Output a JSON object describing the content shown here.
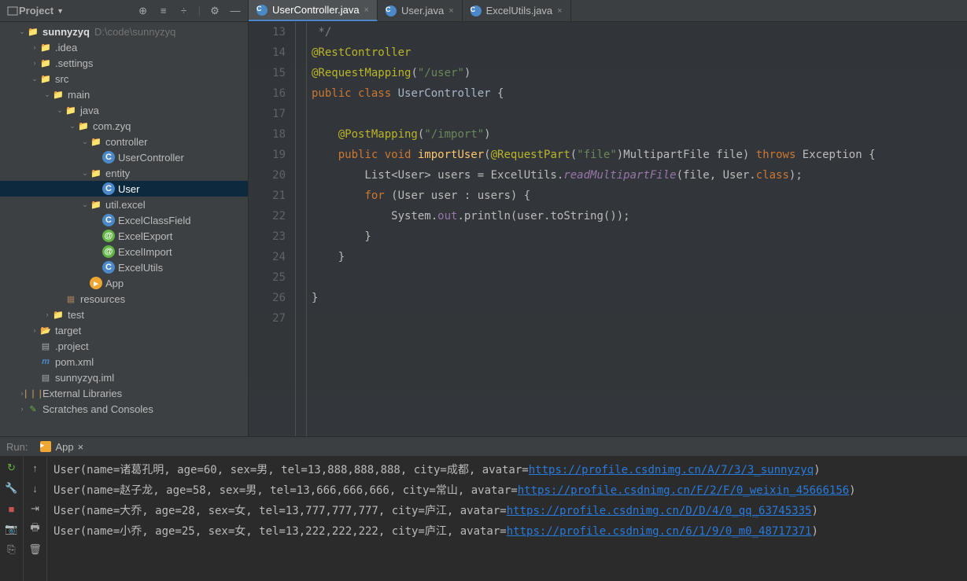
{
  "sidebar": {
    "title": "Project",
    "root": {
      "name": "sunnyzyq",
      "path": "D:\\code\\sunnyzyq"
    },
    "nodes": [
      {
        "d": 1,
        "e": "v",
        "i": "folder-root",
        "n": "sunnyzyq",
        "bold": true,
        "p": "D:\\code\\sunnyzyq"
      },
      {
        "d": 2,
        "e": ">",
        "i": "folder",
        "n": ".idea"
      },
      {
        "d": 2,
        "e": ">",
        "i": "folder",
        "n": ".settings"
      },
      {
        "d": 2,
        "e": "v",
        "i": "folder-blue",
        "n": "src"
      },
      {
        "d": 3,
        "e": "v",
        "i": "folder-blue",
        "n": "main"
      },
      {
        "d": 4,
        "e": "v",
        "i": "folder-blue",
        "n": "java"
      },
      {
        "d": 5,
        "e": "v",
        "i": "folder",
        "n": "com.zyq"
      },
      {
        "d": 6,
        "e": "v",
        "i": "folder",
        "n": "controller"
      },
      {
        "d": 7,
        "e": "",
        "i": "class-c",
        "n": "UserController"
      },
      {
        "d": 6,
        "e": "v",
        "i": "folder",
        "n": "entity"
      },
      {
        "d": 7,
        "e": "",
        "i": "class-c",
        "n": "User",
        "sel": true
      },
      {
        "d": 6,
        "e": "v",
        "i": "folder",
        "n": "util.excel"
      },
      {
        "d": 7,
        "e": "",
        "i": "class-c",
        "n": "ExcelClassField"
      },
      {
        "d": 7,
        "e": "",
        "i": "class-g",
        "n": "ExcelExport"
      },
      {
        "d": 7,
        "e": "",
        "i": "class-g",
        "n": "ExcelImport"
      },
      {
        "d": 7,
        "e": "",
        "i": "class-c",
        "n": "ExcelUtils"
      },
      {
        "d": 6,
        "e": "",
        "i": "class-o",
        "n": "App"
      },
      {
        "d": 4,
        "e": "",
        "i": "folder-res",
        "n": "resources"
      },
      {
        "d": 3,
        "e": ">",
        "i": "folder",
        "n": "test"
      },
      {
        "d": 2,
        "e": ">",
        "i": "folder-open",
        "n": "target"
      },
      {
        "d": 2,
        "e": "",
        "i": "file",
        "n": ".project"
      },
      {
        "d": 2,
        "e": "",
        "i": "maven",
        "n": "pom.xml"
      },
      {
        "d": 2,
        "e": "",
        "i": "file",
        "n": "sunnyzyq.iml"
      },
      {
        "d": 1,
        "e": ">",
        "i": "lib",
        "n": "External Libraries"
      },
      {
        "d": 1,
        "e": ">",
        "i": "scratch",
        "n": "Scratches and Consoles"
      }
    ]
  },
  "tabs": [
    {
      "icon": "class-c",
      "label": "UserController.java",
      "active": true
    },
    {
      "icon": "class-c",
      "label": "User.java",
      "active": false
    },
    {
      "icon": "class-c",
      "label": "ExcelUtils.java",
      "active": false
    }
  ],
  "code": {
    "start": 13,
    "lines": [
      {
        "t": " */",
        "cls": "cm"
      },
      {
        "html": "<span class='ann'>@RestController</span>"
      },
      {
        "html": "<span class='ann'>@RequestMapping</span>(<span class='str'>\"/user\"</span>)"
      },
      {
        "html": "<span class='kw'>public class</span> <span class='cls-n'>UserController</span> {"
      },
      {
        "t": ""
      },
      {
        "html": "    <span class='ann'>@PostMapping</span>(<span class='str'>\"/import\"</span>)"
      },
      {
        "html": "    <span class='kw'>public void</span> <span class='fn'>importUser</span>(<span class='ann'>@RequestPart</span>(<span class='str'>\"file\"</span>)MultipartFile file) <span class='kw'>throws</span> Exception {"
      },
      {
        "html": "        List&lt;User&gt; users = ExcelUtils.<span class='it'>readMultipartFile</span>(file, User.<span class='kw'>class</span>);"
      },
      {
        "html": "        <span class='kw'>for</span> (User user : users) {"
      },
      {
        "html": "            System.<span class='id'>out</span>.println(user.toString());"
      },
      {
        "t": "        }"
      },
      {
        "t": "    }"
      },
      {
        "t": ""
      },
      {
        "t": "}"
      },
      {
        "t": ""
      }
    ]
  },
  "run": {
    "label": "Run:",
    "tab": "App",
    "output": [
      {
        "pre": "User(name=诸葛孔明, age=60, sex=男, tel=13,888,888,888, city=成都, avatar=",
        "url": "https://profile.csdnimg.cn/A/7/3/3_sunnyzyq",
        "post": ")"
      },
      {
        "pre": "User(name=赵子龙, age=58, sex=男, tel=13,666,666,666, city=常山, avatar=",
        "url": "https://profile.csdnimg.cn/F/2/F/0_weixin_45666156",
        "post": ")"
      },
      {
        "pre": "User(name=大乔, age=28, sex=女, tel=13,777,777,777, city=庐江, avatar=",
        "url": "https://profile.csdnimg.cn/D/D/4/0_qq_63745335",
        "post": ")"
      },
      {
        "pre": "User(name=小乔, age=25, sex=女, tel=13,222,222,222, city=庐江, avatar=",
        "url": "https://profile.csdnimg.cn/6/1/9/0_m0_48717371",
        "post": ")"
      }
    ]
  }
}
